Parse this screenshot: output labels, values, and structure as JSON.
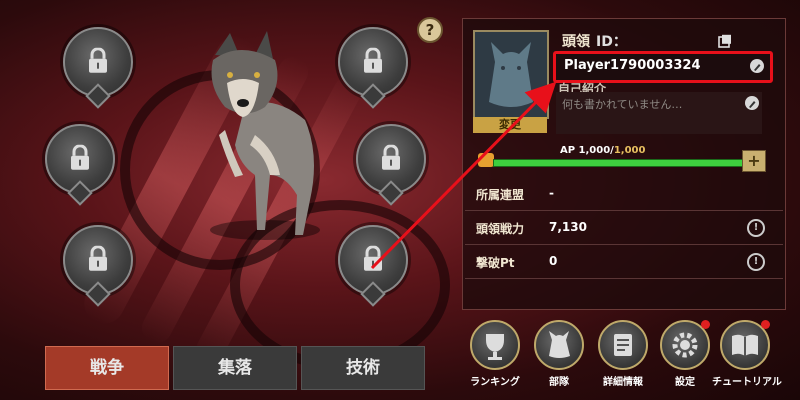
{
  "help_icon_text": "?",
  "tabs": [
    {
      "label": "戦争",
      "active": true
    },
    {
      "label": "集落",
      "active": false
    },
    {
      "label": "技術",
      "active": false
    }
  ],
  "profile": {
    "leader_label": "頭領",
    "id_label": "ID：",
    "player_name": "Player1790003324",
    "change_button": "変更",
    "intro_label": "自己紹介",
    "intro_placeholder": "何も書かれていません…",
    "ap_label": "AP 1,000/",
    "ap_max": "1,000",
    "ap_fill": 1.0,
    "ap_plus": "+"
  },
  "stats": [
    {
      "key": "所属連盟",
      "value": "-"
    },
    {
      "key": "頭領戦力",
      "value": "7,130"
    },
    {
      "key": "撃破Pt",
      "value": "0"
    }
  ],
  "menu": [
    {
      "label": "ランキング",
      "icon": "trophy-icon",
      "badge": false
    },
    {
      "label": "部隊",
      "icon": "wolf-head-icon",
      "badge": false
    },
    {
      "label": "詳細情報",
      "icon": "scroll-icon",
      "badge": false
    },
    {
      "label": "設定",
      "icon": "gear-icon",
      "badge": true
    },
    {
      "label": "チュートリアル",
      "icon": "book-icon",
      "badge": true
    }
  ],
  "colors": {
    "active_tab": "#a43a28",
    "highlight_box": "#e8101a",
    "ap_bar": "#3ecf3e",
    "badge": "#e02020"
  }
}
